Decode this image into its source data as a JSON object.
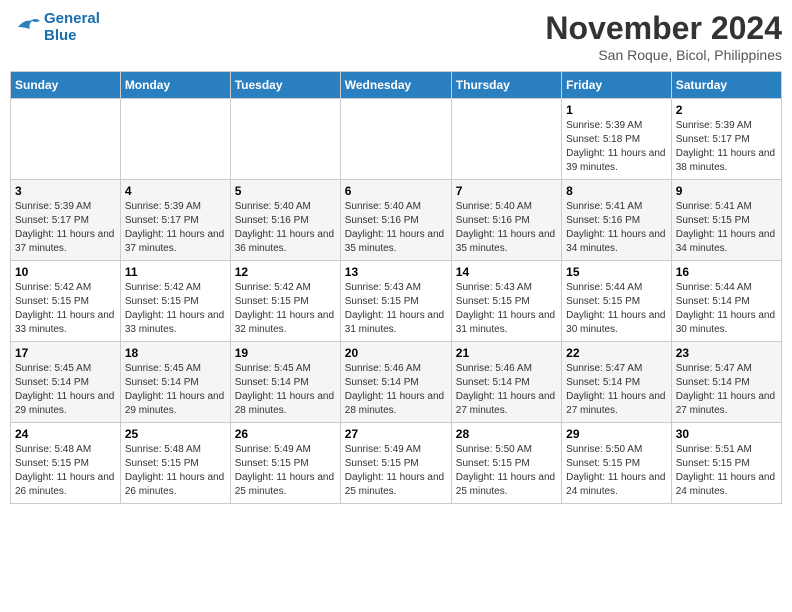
{
  "header": {
    "logo_line1": "General",
    "logo_line2": "Blue",
    "month": "November 2024",
    "location": "San Roque, Bicol, Philippines"
  },
  "weekdays": [
    "Sunday",
    "Monday",
    "Tuesday",
    "Wednesday",
    "Thursday",
    "Friday",
    "Saturday"
  ],
  "weeks": [
    [
      {
        "day": "",
        "info": ""
      },
      {
        "day": "",
        "info": ""
      },
      {
        "day": "",
        "info": ""
      },
      {
        "day": "",
        "info": ""
      },
      {
        "day": "",
        "info": ""
      },
      {
        "day": "1",
        "info": "Sunrise: 5:39 AM\nSunset: 5:18 PM\nDaylight: 11 hours and 39 minutes."
      },
      {
        "day": "2",
        "info": "Sunrise: 5:39 AM\nSunset: 5:17 PM\nDaylight: 11 hours and 38 minutes."
      }
    ],
    [
      {
        "day": "3",
        "info": "Sunrise: 5:39 AM\nSunset: 5:17 PM\nDaylight: 11 hours and 37 minutes."
      },
      {
        "day": "4",
        "info": "Sunrise: 5:39 AM\nSunset: 5:17 PM\nDaylight: 11 hours and 37 minutes."
      },
      {
        "day": "5",
        "info": "Sunrise: 5:40 AM\nSunset: 5:16 PM\nDaylight: 11 hours and 36 minutes."
      },
      {
        "day": "6",
        "info": "Sunrise: 5:40 AM\nSunset: 5:16 PM\nDaylight: 11 hours and 35 minutes."
      },
      {
        "day": "7",
        "info": "Sunrise: 5:40 AM\nSunset: 5:16 PM\nDaylight: 11 hours and 35 minutes."
      },
      {
        "day": "8",
        "info": "Sunrise: 5:41 AM\nSunset: 5:16 PM\nDaylight: 11 hours and 34 minutes."
      },
      {
        "day": "9",
        "info": "Sunrise: 5:41 AM\nSunset: 5:15 PM\nDaylight: 11 hours and 34 minutes."
      }
    ],
    [
      {
        "day": "10",
        "info": "Sunrise: 5:42 AM\nSunset: 5:15 PM\nDaylight: 11 hours and 33 minutes."
      },
      {
        "day": "11",
        "info": "Sunrise: 5:42 AM\nSunset: 5:15 PM\nDaylight: 11 hours and 33 minutes."
      },
      {
        "day": "12",
        "info": "Sunrise: 5:42 AM\nSunset: 5:15 PM\nDaylight: 11 hours and 32 minutes."
      },
      {
        "day": "13",
        "info": "Sunrise: 5:43 AM\nSunset: 5:15 PM\nDaylight: 11 hours and 31 minutes."
      },
      {
        "day": "14",
        "info": "Sunrise: 5:43 AM\nSunset: 5:15 PM\nDaylight: 11 hours and 31 minutes."
      },
      {
        "day": "15",
        "info": "Sunrise: 5:44 AM\nSunset: 5:15 PM\nDaylight: 11 hours and 30 minutes."
      },
      {
        "day": "16",
        "info": "Sunrise: 5:44 AM\nSunset: 5:14 PM\nDaylight: 11 hours and 30 minutes."
      }
    ],
    [
      {
        "day": "17",
        "info": "Sunrise: 5:45 AM\nSunset: 5:14 PM\nDaylight: 11 hours and 29 minutes."
      },
      {
        "day": "18",
        "info": "Sunrise: 5:45 AM\nSunset: 5:14 PM\nDaylight: 11 hours and 29 minutes."
      },
      {
        "day": "19",
        "info": "Sunrise: 5:45 AM\nSunset: 5:14 PM\nDaylight: 11 hours and 28 minutes."
      },
      {
        "day": "20",
        "info": "Sunrise: 5:46 AM\nSunset: 5:14 PM\nDaylight: 11 hours and 28 minutes."
      },
      {
        "day": "21",
        "info": "Sunrise: 5:46 AM\nSunset: 5:14 PM\nDaylight: 11 hours and 27 minutes."
      },
      {
        "day": "22",
        "info": "Sunrise: 5:47 AM\nSunset: 5:14 PM\nDaylight: 11 hours and 27 minutes."
      },
      {
        "day": "23",
        "info": "Sunrise: 5:47 AM\nSunset: 5:14 PM\nDaylight: 11 hours and 27 minutes."
      }
    ],
    [
      {
        "day": "24",
        "info": "Sunrise: 5:48 AM\nSunset: 5:15 PM\nDaylight: 11 hours and 26 minutes."
      },
      {
        "day": "25",
        "info": "Sunrise: 5:48 AM\nSunset: 5:15 PM\nDaylight: 11 hours and 26 minutes."
      },
      {
        "day": "26",
        "info": "Sunrise: 5:49 AM\nSunset: 5:15 PM\nDaylight: 11 hours and 25 minutes."
      },
      {
        "day": "27",
        "info": "Sunrise: 5:49 AM\nSunset: 5:15 PM\nDaylight: 11 hours and 25 minutes."
      },
      {
        "day": "28",
        "info": "Sunrise: 5:50 AM\nSunset: 5:15 PM\nDaylight: 11 hours and 25 minutes."
      },
      {
        "day": "29",
        "info": "Sunrise: 5:50 AM\nSunset: 5:15 PM\nDaylight: 11 hours and 24 minutes."
      },
      {
        "day": "30",
        "info": "Sunrise: 5:51 AM\nSunset: 5:15 PM\nDaylight: 11 hours and 24 minutes."
      }
    ]
  ]
}
